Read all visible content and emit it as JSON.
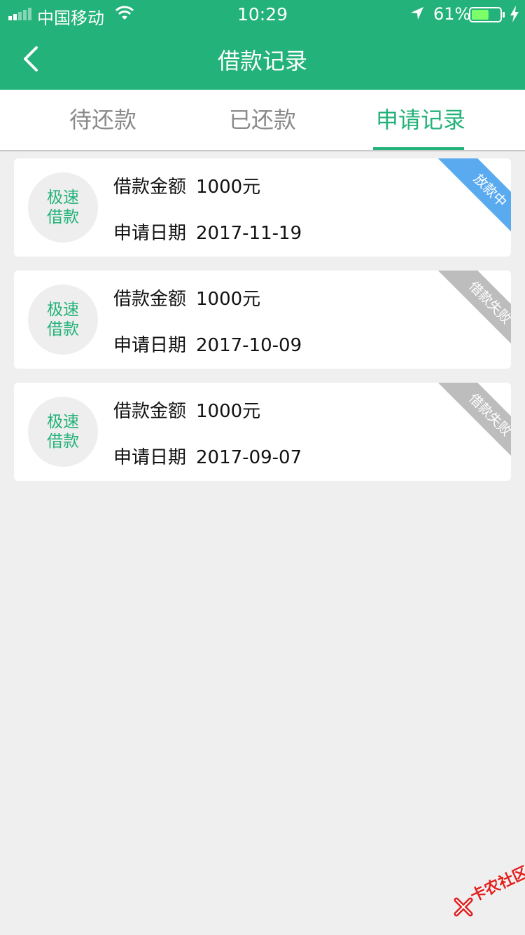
{
  "status_bar": {
    "carrier": "中国移动",
    "time": "10:29",
    "battery_percent": "61%",
    "battery_level": 0.61
  },
  "nav": {
    "title": "借款记录",
    "back_icon": "chevron-left-icon"
  },
  "tabs": [
    {
      "label": "待还款",
      "active": false
    },
    {
      "label": "已还款",
      "active": false
    },
    {
      "label": "申请记录",
      "active": true
    }
  ],
  "records": [
    {
      "badge_line1": "极速",
      "badge_line2": "借款",
      "amount_label": "借款金额",
      "amount": "1000元",
      "date_label": "申请日期",
      "date": "2017-11-19",
      "status": "放款中",
      "status_color": "#5aaaf0"
    },
    {
      "badge_line1": "极速",
      "badge_line2": "借款",
      "amount_label": "借款金额",
      "amount": "1000元",
      "date_label": "申请日期",
      "date": "2017-10-09",
      "status": "借款失败",
      "status_color": "#bdbdbd"
    },
    {
      "badge_line1": "极速",
      "badge_line2": "借款",
      "amount_label": "借款金额",
      "amount": "1000元",
      "date_label": "申请日期",
      "date": "2017-09-07",
      "status": "借款失败",
      "status_color": "#bdbdbd"
    }
  ],
  "watermark": {
    "text": "卡农社区"
  },
  "colors": {
    "brand": "#23b27a",
    "background": "#efefef",
    "ribbon_processing": "#5aaaf0",
    "ribbon_failed": "#bdbdbd"
  }
}
